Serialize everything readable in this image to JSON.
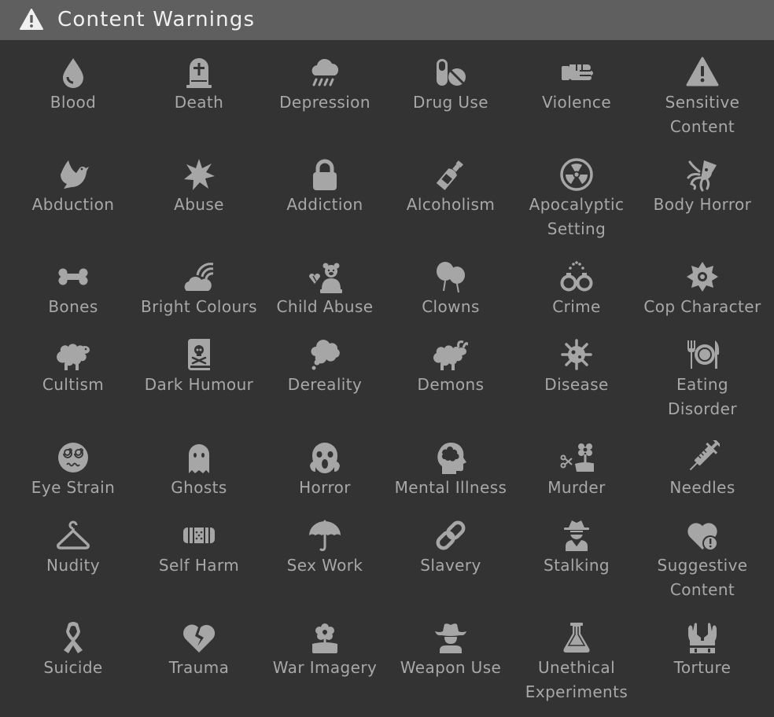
{
  "header": {
    "icon": "warning-icon",
    "title": "Content Warnings",
    "colors": {
      "bar": "#5f5f5f",
      "background": "#333333",
      "text": "#a6a6a6",
      "title": "#f0f0f0"
    }
  },
  "items": [
    {
      "label": "Blood",
      "icon": "blood-drop-icon"
    },
    {
      "label": "Death",
      "icon": "tombstone-icon"
    },
    {
      "label": "Depression",
      "icon": "rain-cloud-icon"
    },
    {
      "label": "Drug Use",
      "icon": "pills-icon"
    },
    {
      "label": "Violence",
      "icon": "fist-icon"
    },
    {
      "label": "Sensitive\nContent",
      "icon": "warning-icon"
    },
    {
      "label": "Abduction",
      "icon": "dove-icon"
    },
    {
      "label": "Abuse",
      "icon": "burst-icon"
    },
    {
      "label": "Addiction",
      "icon": "lock-icon"
    },
    {
      "label": "Alcoholism",
      "icon": "bottle-icon"
    },
    {
      "label": "Apocalyptic\nSetting",
      "icon": "radiation-icon"
    },
    {
      "label": "Body Horror",
      "icon": "squid-icon"
    },
    {
      "label": "Bones",
      "icon": "bone-icon"
    },
    {
      "label": "Bright Colours",
      "icon": "rainbow-icon"
    },
    {
      "label": "Child Abuse",
      "icon": "teddy-bear-icon"
    },
    {
      "label": "Clowns",
      "icon": "balloons-icon"
    },
    {
      "label": "Crime",
      "icon": "handcuffs-icon"
    },
    {
      "label": "Cop Character",
      "icon": "badge-icon"
    },
    {
      "label": "Cultism",
      "icon": "sheep-icon"
    },
    {
      "label": "Dark Humour",
      "icon": "skull-book-icon"
    },
    {
      "label": "Dereality",
      "icon": "thought-bubble-icon"
    },
    {
      "label": "Demons",
      "icon": "goat-icon"
    },
    {
      "label": "Disease",
      "icon": "virus-icon"
    },
    {
      "label": "Eating\nDisorder",
      "icon": "cutlery-plate-icon"
    },
    {
      "label": "Eye Strain",
      "icon": "dizzy-face-icon"
    },
    {
      "label": "Ghosts",
      "icon": "ghost-icon"
    },
    {
      "label": "Horror",
      "icon": "screaming-face-icon"
    },
    {
      "label": "Mental Illness",
      "icon": "brain-head-icon"
    },
    {
      "label": "Murder",
      "icon": "scissors-flower-icon"
    },
    {
      "label": "Needles",
      "icon": "syringe-icon"
    },
    {
      "label": "Nudity",
      "icon": "hanger-icon"
    },
    {
      "label": "Self Harm",
      "icon": "bandage-icon"
    },
    {
      "label": "Sex Work",
      "icon": "umbrella-icon"
    },
    {
      "label": "Slavery",
      "icon": "chain-icon"
    },
    {
      "label": "Stalking",
      "icon": "spy-icon"
    },
    {
      "label": "Suggestive\nContent",
      "icon": "heart-alert-icon"
    },
    {
      "label": "Suicide",
      "icon": "ribbon-icon"
    },
    {
      "label": "Trauma",
      "icon": "broken-heart-icon"
    },
    {
      "label": "War Imagery",
      "icon": "poppy-icon"
    },
    {
      "label": "Weapon Use",
      "icon": "cowboy-icon"
    },
    {
      "label": "Unethical\nExperiments",
      "icon": "flask-icon"
    },
    {
      "label": "Torture",
      "icon": "hands-restraint-icon"
    }
  ]
}
